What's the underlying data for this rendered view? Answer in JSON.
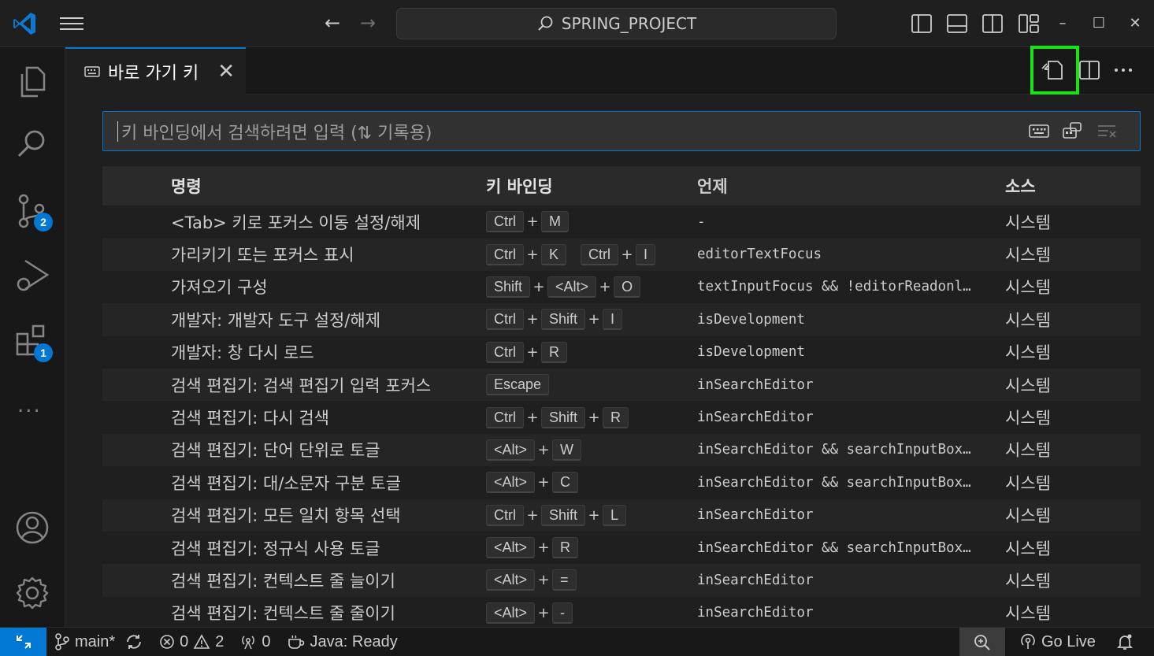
{
  "titlebar": {
    "search_text": "SPRING_PROJECT"
  },
  "activity_bar": {
    "scm_badge": "2",
    "extensions_badge": "1",
    "more": "..."
  },
  "tab": {
    "title": "바로 가기 키",
    "close": "✕"
  },
  "keybindings_search": {
    "placeholder": "키 바인딩에서 검색하려면 입력 (⇅ 기록용)"
  },
  "table": {
    "headers": {
      "command": "명령",
      "keybinding": "키 바인딩",
      "when": "언제",
      "source": "소스"
    },
    "rows": [
      {
        "command": "<Tab> 키로 포커스 이동 설정/해제",
        "keys": [
          [
            "Ctrl",
            "M"
          ]
        ],
        "when": "-",
        "source": "시스템"
      },
      {
        "command": "가리키기 또는 포커스 표시",
        "keys": [
          [
            "Ctrl",
            "K"
          ],
          [
            "Ctrl",
            "I"
          ]
        ],
        "when": "editorTextFocus",
        "source": "시스템"
      },
      {
        "command": "가져오기 구성",
        "keys": [
          [
            "Shift",
            "<Alt>",
            "O"
          ]
        ],
        "when": "textInputFocus && !editorReadonl…",
        "source": "시스템"
      },
      {
        "command": "개발자: 개발자 도구 설정/해제",
        "keys": [
          [
            "Ctrl",
            "Shift",
            "I"
          ]
        ],
        "when": "isDevelopment",
        "source": "시스템"
      },
      {
        "command": "개발자: 창 다시 로드",
        "keys": [
          [
            "Ctrl",
            "R"
          ]
        ],
        "when": "isDevelopment",
        "source": "시스템"
      },
      {
        "command": "검색 편집기: 검색 편집기 입력 포커스",
        "keys": [
          [
            "Escape"
          ]
        ],
        "when": "inSearchEditor",
        "source": "시스템"
      },
      {
        "command": "검색 편집기: 다시 검색",
        "keys": [
          [
            "Ctrl",
            "Shift",
            "R"
          ]
        ],
        "when": "inSearchEditor",
        "source": "시스템"
      },
      {
        "command": "검색 편집기: 단어 단위로 토글",
        "keys": [
          [
            "<Alt>",
            "W"
          ]
        ],
        "when": "inSearchEditor && searchInputBox…",
        "source": "시스템"
      },
      {
        "command": "검색 편집기: 대/소문자 구분 토글",
        "keys": [
          [
            "<Alt>",
            "C"
          ]
        ],
        "when": "inSearchEditor && searchInputBox…",
        "source": "시스템"
      },
      {
        "command": "검색 편집기: 모든 일치 항목 선택",
        "keys": [
          [
            "Ctrl",
            "Shift",
            "L"
          ]
        ],
        "when": "inSearchEditor",
        "source": "시스템"
      },
      {
        "command": "검색 편집기: 정규식 사용 토글",
        "keys": [
          [
            "<Alt>",
            "R"
          ]
        ],
        "when": "inSearchEditor && searchInputBox…",
        "source": "시스템"
      },
      {
        "command": "검색 편집기: 컨텍스트 줄 늘이기",
        "keys": [
          [
            "<Alt>",
            "="
          ]
        ],
        "when": "inSearchEditor",
        "source": "시스템"
      },
      {
        "command": "검색 편집기: 컨텍스트 줄 줄이기",
        "keys": [
          [
            "<Alt>",
            "-"
          ]
        ],
        "when": "inSearchEditor",
        "source": "시스템"
      }
    ]
  },
  "statusbar": {
    "branch": "main*",
    "errors": "0",
    "warnings": "2",
    "ports": "0",
    "java": "Java: Ready",
    "golive": "Go Live"
  },
  "colors": {
    "accent": "#0078d4",
    "highlight": "#17e317"
  }
}
